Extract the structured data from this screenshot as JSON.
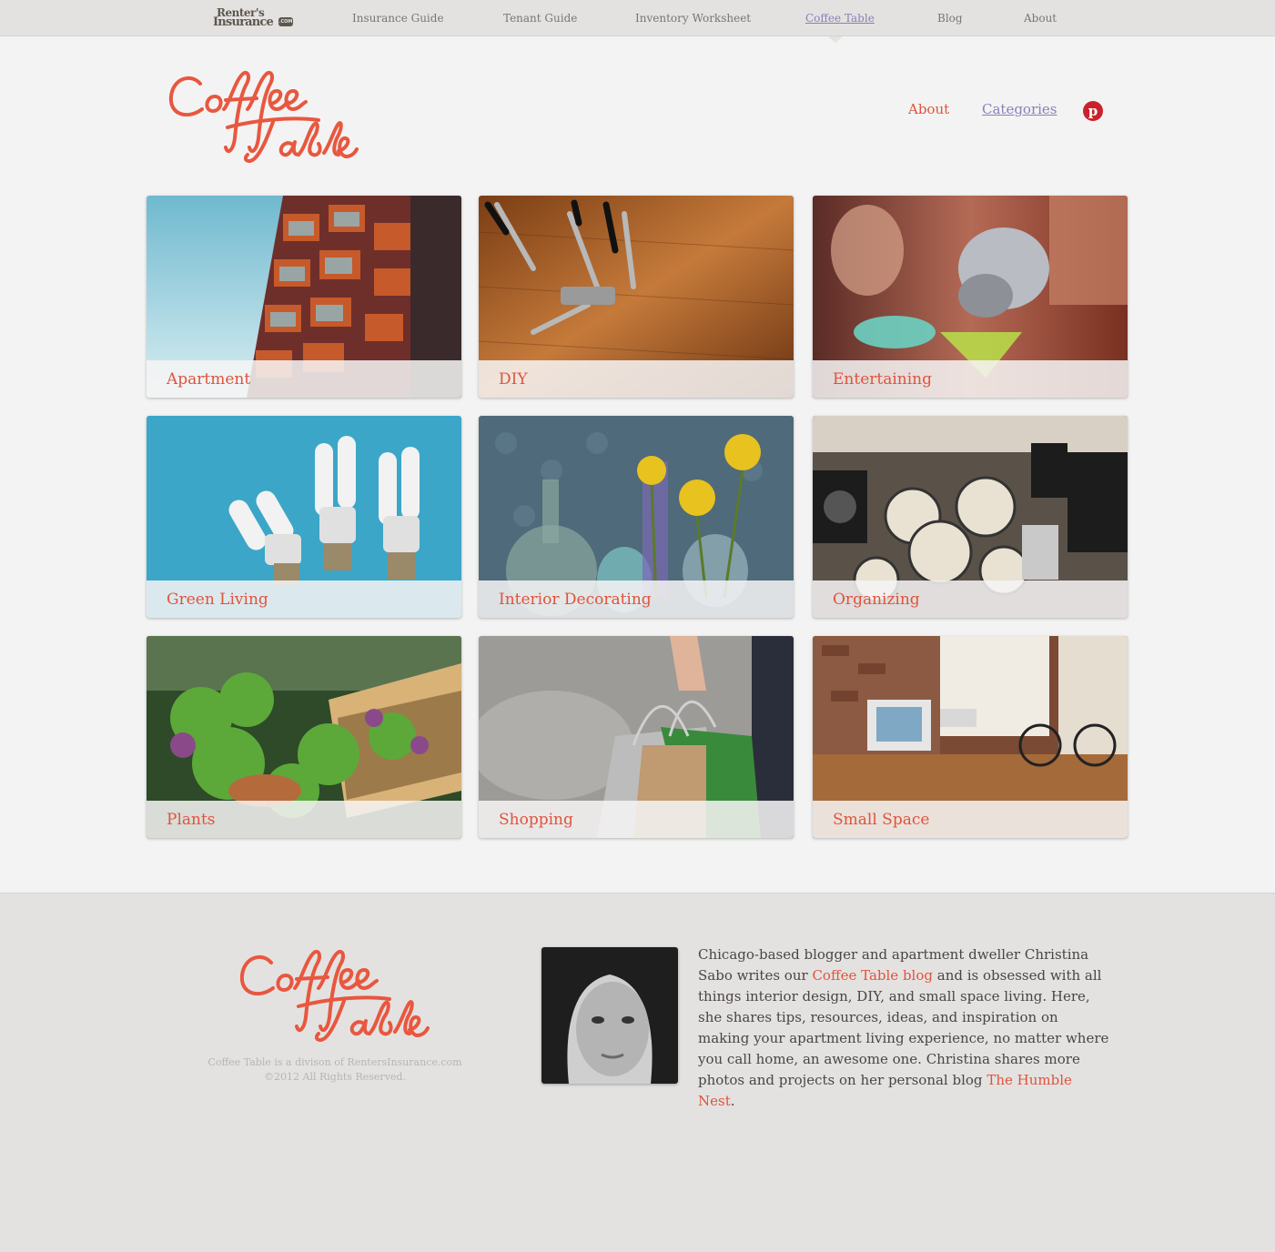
{
  "topnav": {
    "logo_line1": "Renter's",
    "logo_line2": "Insurance",
    "logo_com": ".COM",
    "links": [
      {
        "label": "Insurance Guide"
      },
      {
        "label": "Tenant Guide"
      },
      {
        "label": "Inventory Worksheet"
      },
      {
        "label": "Coffee Table",
        "active": true
      },
      {
        "label": "Blog"
      },
      {
        "label": "About"
      }
    ]
  },
  "header": {
    "brand_alt": "Coffee Table",
    "about_label": "About",
    "categories_label": "Categories",
    "pinterest_icon": "pinterest-icon",
    "pinterest_glyph": "p"
  },
  "categories": [
    {
      "label": "Apartment"
    },
    {
      "label": "DIY"
    },
    {
      "label": "Entertaining"
    },
    {
      "label": "Green Living"
    },
    {
      "label": "Interior Decorating"
    },
    {
      "label": "Organizing"
    },
    {
      "label": "Plants"
    },
    {
      "label": "Shopping"
    },
    {
      "label": "Small Space"
    }
  ],
  "footer": {
    "brand_alt": "Coffee Table",
    "note_line1": "Coffee Table is a divison of RentersInsurance.com",
    "note_line2": "©2012 All Rights Reserved.",
    "bio_part1": "Chicago-based blogger and apartment dweller Christina Sabo writes our ",
    "bio_link1": "Coffee Table blog",
    "bio_part2": " and is obsessed with all things interior design, DIY, and small space living. Here, she shares tips, resources, ideas, and inspiration on making your apartment living experience, no matter where you call home, an awesome one. Christina shares more photos and projects on her personal blog ",
    "bio_link2": "The Humble Nest",
    "bio_part3": "."
  },
  "colors": {
    "accent": "#e0533c",
    "link_active": "#8a80b8",
    "topbar": "#e4e2e0",
    "page": "#f3f3f3",
    "pinterest": "#c8232c"
  }
}
